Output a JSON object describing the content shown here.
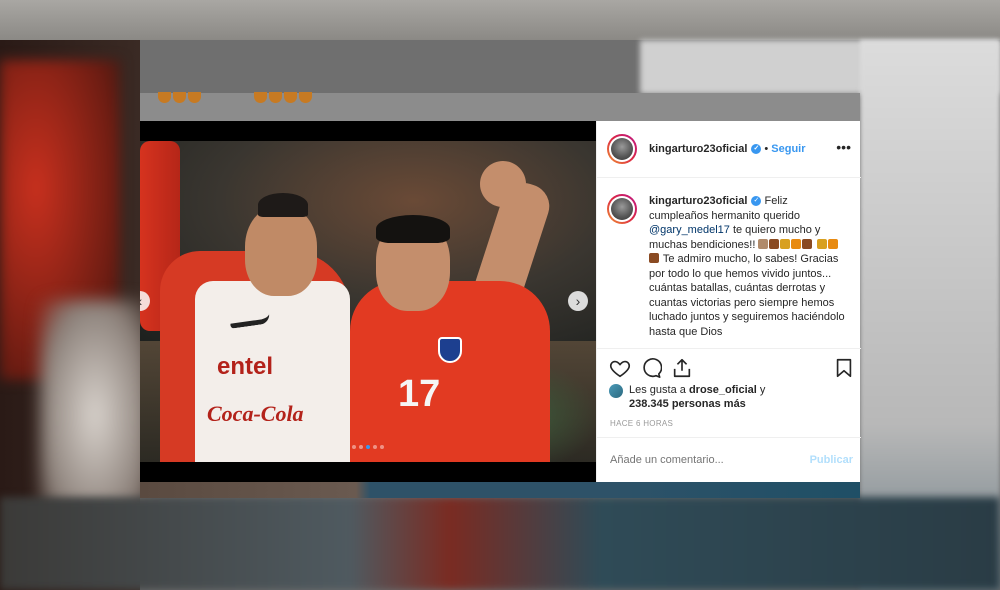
{
  "post": {
    "username": "kingarturo23oficial",
    "verified_badge": "verified-icon",
    "separator": "•",
    "follow_label": "Seguir",
    "more_label": "•••",
    "caption": {
      "author": "kingarturo23oficial",
      "text_1": "Feliz cumpleaños hermanito querido",
      "mention": "@gary_medel17",
      "text_2": "te quiero mucho y muchas bendiciones!!",
      "text_3": "Te admiro mucho, lo sabes! Gracias por todo lo que hemos vivido juntos... cuántas batallas, cuántas derrotas y cuantas victorias pero siempre hemos luchado juntos y seguiremos haciéndolo hasta que Dios"
    },
    "photo": {
      "jersey_number": "17",
      "bib_brand_1": "entel",
      "bib_brand_2": "Coca-Cola"
    },
    "carousel": {
      "next_arrow": "›",
      "prev_arrow": "‹",
      "dot_count": 5,
      "active_dot": 3
    },
    "likes": {
      "prefix": "Les gusta a",
      "user": "drose_oficial",
      "connector": "y",
      "count_text": "238.345 personas más"
    },
    "timestamp": "HACE 6 HORAS",
    "comment": {
      "placeholder": "Añade un comentario...",
      "publish_label": "Publicar"
    }
  },
  "colors": {
    "accent_blue": "#3897f0",
    "mention_blue": "#003569",
    "publish_disabled": "#b2dffc",
    "text": "#262626",
    "muted": "#999999"
  }
}
